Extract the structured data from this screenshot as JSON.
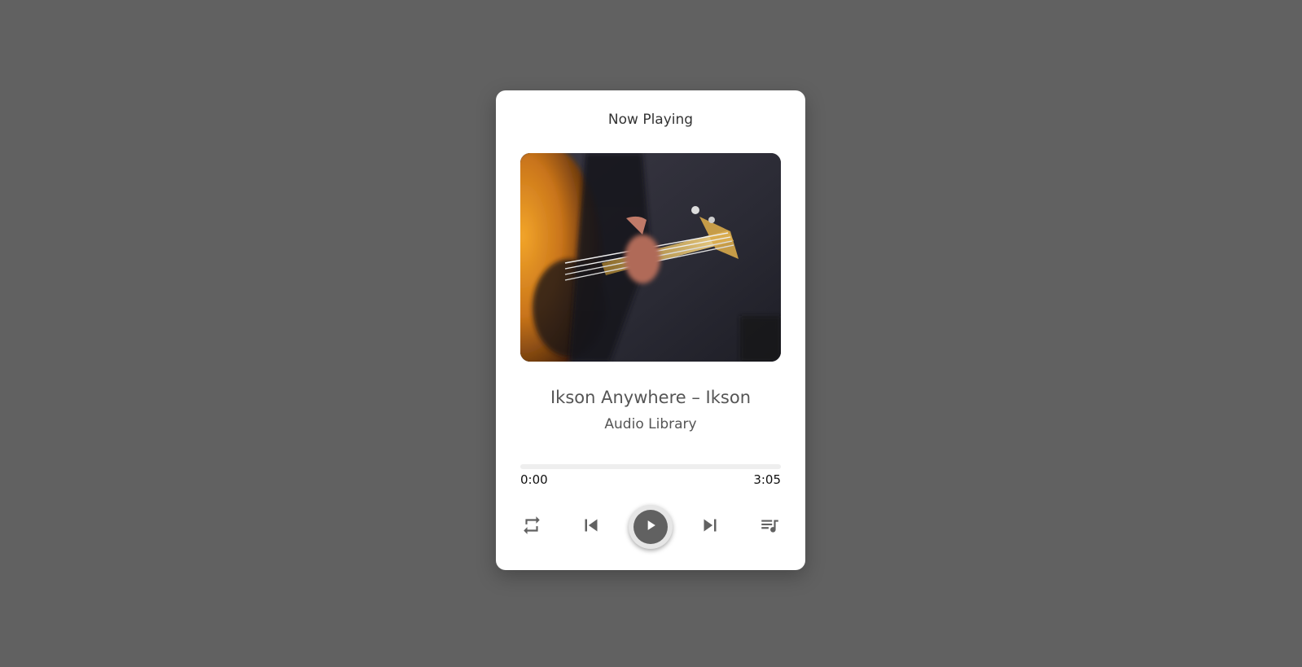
{
  "player": {
    "header": "Now Playing",
    "track": {
      "title": "Ikson Anywhere – Ikson",
      "artist": "Audio Library"
    },
    "progress": {
      "current": "0:00",
      "total": "3:05",
      "fraction": 0
    },
    "controls": {
      "repeat_icon": "repeat-icon",
      "previous_icon": "skip-previous-icon",
      "play_icon": "play-icon",
      "next_icon": "skip-next-icon",
      "playlist_icon": "queue-music-icon"
    }
  },
  "colors": {
    "background": "#616161",
    "card": "#ffffff",
    "icon": "#616161",
    "text": "#555555"
  }
}
